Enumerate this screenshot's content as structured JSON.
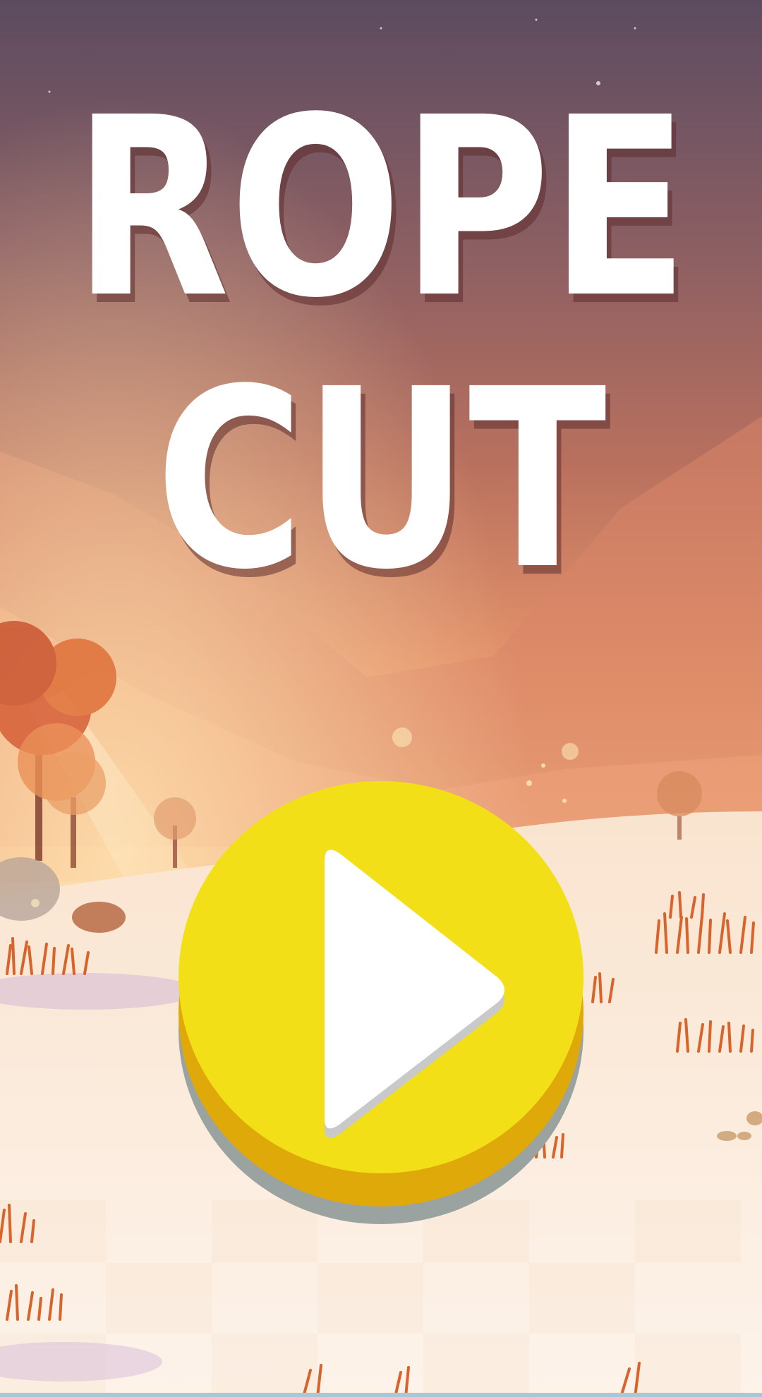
{
  "title": {
    "line1": "ROPE",
    "line2": "CUT"
  },
  "play_button": {
    "icon": "play-icon"
  },
  "colors": {
    "sky_top": "#5c4b60",
    "sky_mid": "#b8705e",
    "sky_glow": "#f0a06a",
    "snow": "#fbeee0",
    "button_face": "#f2df18",
    "button_rim": "#e0a90a",
    "button_shadow": "#9aa3a0",
    "title_text": "#ffffff"
  }
}
